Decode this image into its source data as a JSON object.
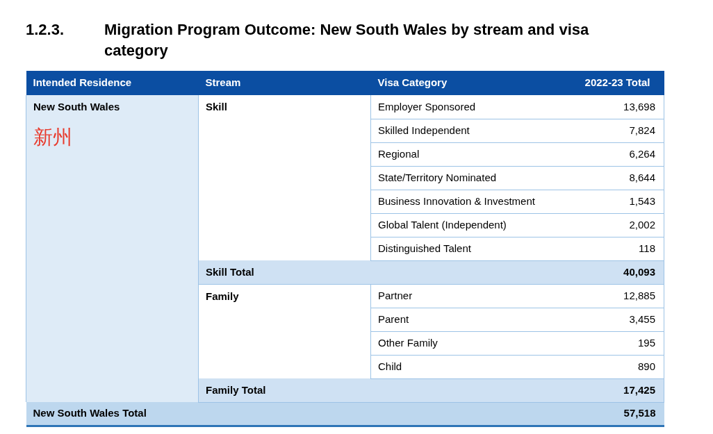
{
  "heading": {
    "number": "1.2.3.",
    "title": "Migration Program Outcome: New South Wales by stream and visa category"
  },
  "table": {
    "columns": [
      "Intended Residence",
      "Stream",
      "Visa Category",
      "2022-23 Total"
    ],
    "residence": {
      "name": "New South Wales",
      "annotation": "新州"
    },
    "streams": [
      {
        "name": "Skill",
        "rows": [
          {
            "category": "Employer Sponsored",
            "total": "13,698"
          },
          {
            "category": "Skilled Independent",
            "total": "7,824"
          },
          {
            "category": "Regional",
            "total": "6,264"
          },
          {
            "category": "State/Territory Nominated",
            "total": "8,644"
          },
          {
            "category": "Business Innovation & Investment",
            "total": "1,543"
          },
          {
            "category": "Global Talent (Independent)",
            "total": "2,002"
          },
          {
            "category": "Distinguished Talent",
            "total": "118"
          }
        ],
        "total_label": "Skill Total",
        "total": "40,093"
      },
      {
        "name": "Family",
        "rows": [
          {
            "category": "Partner",
            "total": "12,885"
          },
          {
            "category": "Parent",
            "total": "3,455"
          },
          {
            "category": "Other Family",
            "total": "195"
          },
          {
            "category": "Child",
            "total": "890"
          }
        ],
        "total_label": "Family Total",
        "total": "17,425"
      }
    ],
    "grand_total": {
      "label": "New South Wales Total",
      "total": "57,518"
    }
  }
}
